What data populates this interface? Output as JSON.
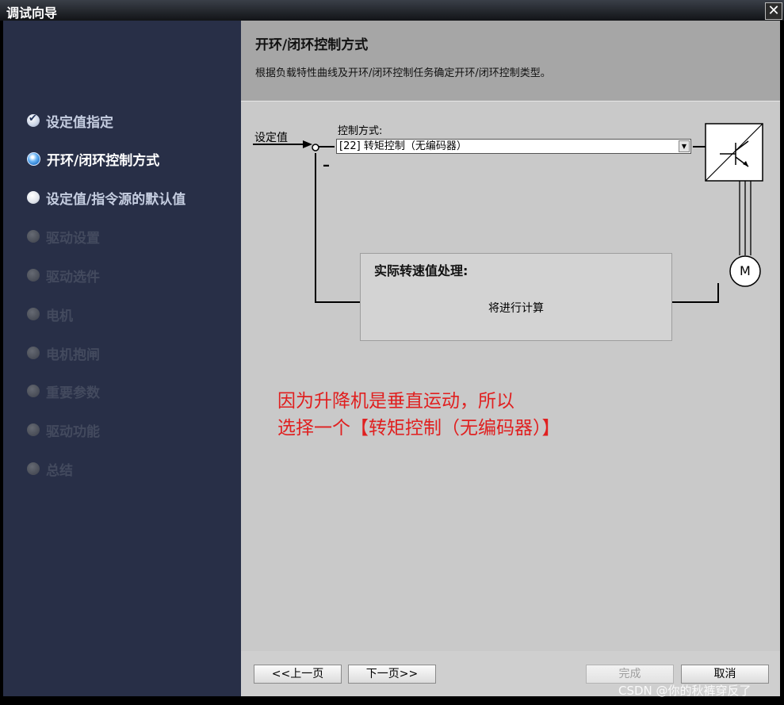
{
  "window": {
    "title": "调试向导",
    "close_symbol": "✕"
  },
  "sidebar": {
    "steps": [
      {
        "label": "设定值指定",
        "state": "done"
      },
      {
        "label": "开环/闭环控制方式",
        "state": "current"
      },
      {
        "label": "设定值/指令源的默认值",
        "state": "pending"
      },
      {
        "label": "驱动设置",
        "state": "disabled"
      },
      {
        "label": "驱动选件",
        "state": "disabled"
      },
      {
        "label": "电机",
        "state": "disabled"
      },
      {
        "label": "电机抱闸",
        "state": "disabled"
      },
      {
        "label": "重要参数",
        "state": "disabled"
      },
      {
        "label": "驱动功能",
        "state": "disabled"
      },
      {
        "label": "总结",
        "state": "disabled"
      }
    ]
  },
  "header": {
    "title": "开环/闭环控制方式",
    "description": "根据负载特性曲线及开环/闭环控制任务确定开环/闭环控制类型。"
  },
  "diagram": {
    "setpoint_label": "设定值",
    "control_mode_label": "控制方式:",
    "control_mode_value": "[22] 转矩控制（无编码器）",
    "minus_sign": "–",
    "motor_label": "M",
    "processing_title": "实际转速值处理:",
    "processing_value": "将进行计算"
  },
  "annotation": {
    "line1": "因为升降机是垂直运动，所以",
    "line2": "选择一个【转矩控制（无编码器）】"
  },
  "footer": {
    "prev_label": "<<上一页",
    "next_label": "下一页>>",
    "finish_label": "完成",
    "cancel_label": "取消"
  },
  "watermark": "CSDN @你的秋裤穿反了",
  "colors": {
    "sidebar_bg": "#282f47",
    "content_bg": "#c9c9c9",
    "header_bg": "#a6a6a6",
    "annotation": "#e02020"
  }
}
